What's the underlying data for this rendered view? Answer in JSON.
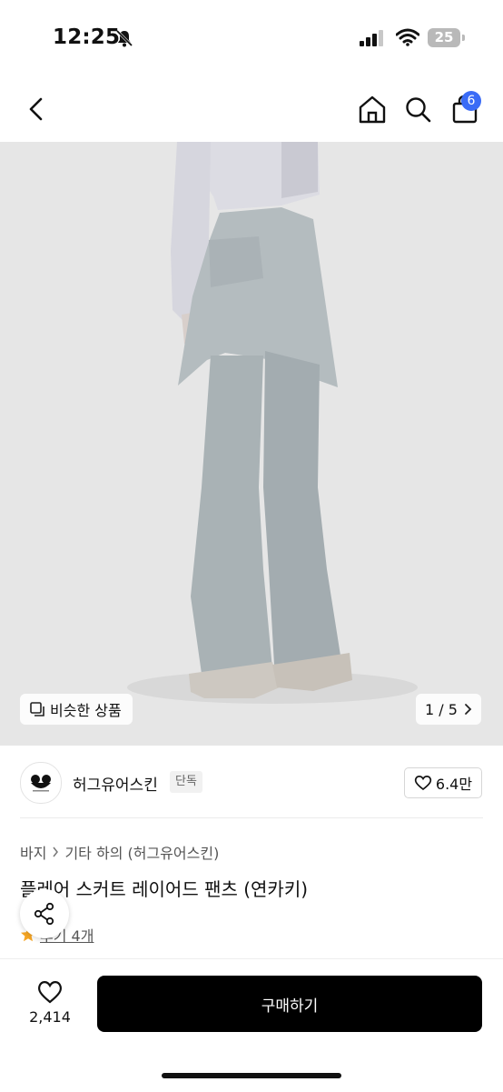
{
  "status": {
    "time": "12:25",
    "battery": "25"
  },
  "nav": {
    "cart_badge": "6"
  },
  "gallery": {
    "similar_label": "비슷한 상품",
    "page": "1 / 5"
  },
  "brand": {
    "name": "허그유어스킨",
    "exclusive_badge": "단독",
    "likes": "6.4만"
  },
  "breadcrumb": {
    "category": "바지",
    "subcategory": "기타 하의 (허그유어스킨)"
  },
  "product": {
    "title": "플레어 스커트 레이어드 팬츠 (연카키)",
    "review_label": "후기 4개"
  },
  "bottom": {
    "wish_count": "2,414",
    "buy_label": "구매하기"
  },
  "colors": {
    "accent": "#3b6cf6",
    "buy_button": "#000000",
    "photo_background": "#e6e6e6",
    "pants": "#a9b2b5"
  }
}
